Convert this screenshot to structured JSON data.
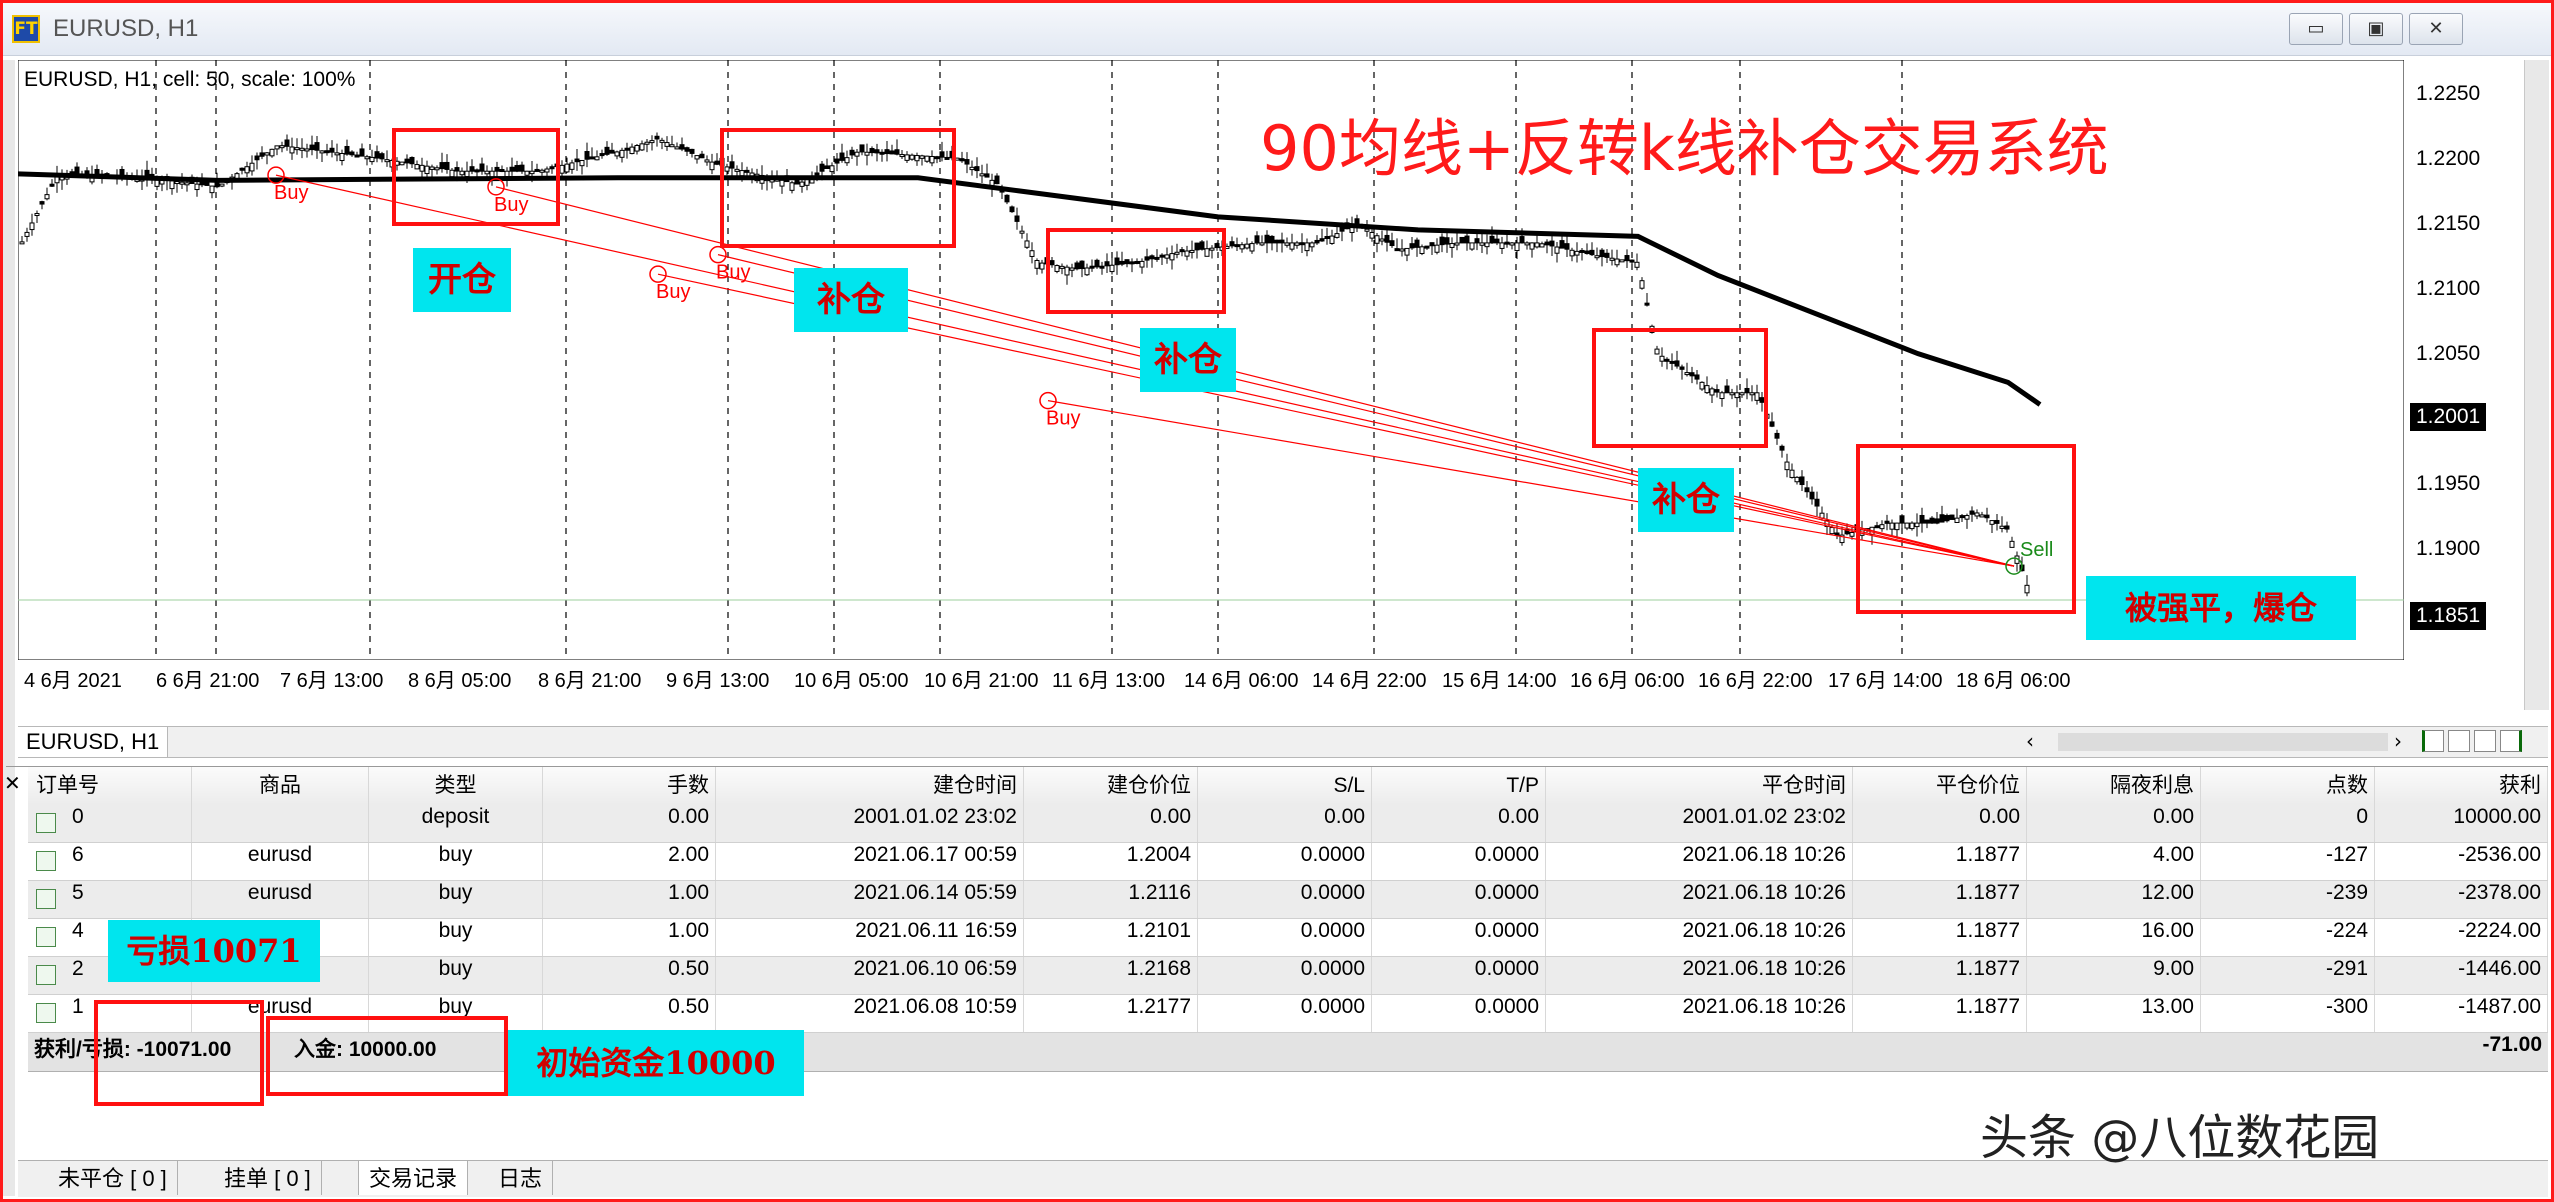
{
  "window": {
    "title": "EURUSD, H1",
    "minimize_glyph": "▭",
    "restore_glyph": "▣",
    "close_glyph": "✕",
    "app_icon_text": "FT"
  },
  "chart": {
    "info_label": "EURUSD, H1, cell: 50, scale: 100%",
    "headline": "90均线+反转k线补仓交易系统",
    "price_labels": [
      "1.2250",
      "1.2200",
      "1.2150",
      "1.2100",
      "1.2050",
      "1.2001",
      "1.1950",
      "1.1900",
      "1.1851"
    ],
    "current_price": "1.2001",
    "bid_price": "1.1851",
    "time_labels": [
      "4 6月 2021",
      "6 6月 21:00",
      "7 6月 13:00",
      "8 6月 05:00",
      "8 6月 21:00",
      "9 6月 13:00",
      "10 6月 05:00",
      "10 6月 21:00",
      "11 6月 13:00",
      "14 6月 06:00",
      "14 6月 22:00",
      "15 6月 14:00",
      "16 6月 06:00",
      "16 6月 22:00",
      "17 6月 14:00",
      "18 6月 06:00"
    ],
    "trade_markers": [
      "Buy",
      "Buy",
      "Buy",
      "Buy",
      "Buy",
      "Sell"
    ],
    "annotations": {
      "open": "开仓",
      "add1": "补仓",
      "add2": "补仓",
      "add3": "补仓",
      "liquidated": "被强平，爆仓",
      "loss": "亏损10071",
      "initial": "初始资金10000"
    }
  },
  "chart_tab": "EURUSD, H1",
  "table": {
    "headers": [
      "订单号",
      "商品",
      "类型",
      "手数",
      "建仓时间",
      "建仓价位",
      "S/L",
      "T/P",
      "平仓时间",
      "平仓价位",
      "隔夜利息",
      "点数",
      "获利"
    ],
    "rows": [
      [
        "0",
        "",
        "deposit",
        "0.00",
        "2001.01.02 23:02",
        "0.00",
        "0.00",
        "0.00",
        "2001.01.02 23:02",
        "0.00",
        "0.00",
        "0",
        "10000.00"
      ],
      [
        "6",
        "eurusd",
        "buy",
        "2.00",
        "2021.06.17 00:59",
        "1.2004",
        "0.0000",
        "0.0000",
        "2021.06.18 10:26",
        "1.1877",
        "4.00",
        "-127",
        "-2536.00"
      ],
      [
        "5",
        "eurusd",
        "buy",
        "1.00",
        "2021.06.14 05:59",
        "1.2116",
        "0.0000",
        "0.0000",
        "2021.06.18 10:26",
        "1.1877",
        "12.00",
        "-239",
        "-2378.00"
      ],
      [
        "4",
        "eurusd",
        "buy",
        "1.00",
        "2021.06.11 16:59",
        "1.2101",
        "0.0000",
        "0.0000",
        "2021.06.18 10:26",
        "1.1877",
        "16.00",
        "-224",
        "-2224.00"
      ],
      [
        "2",
        "eurusd",
        "buy",
        "0.50",
        "2021.06.10 06:59",
        "1.2168",
        "0.0000",
        "0.0000",
        "2021.06.18 10:26",
        "1.1877",
        "9.00",
        "-291",
        "-1446.00"
      ],
      [
        "1",
        "eurusd",
        "buy",
        "0.50",
        "2021.06.08 10:59",
        "1.2177",
        "0.0000",
        "0.0000",
        "2021.06.18 10:26",
        "1.1877",
        "13.00",
        "-300",
        "-1487.00"
      ]
    ],
    "summary_pl_label": "获利/亏损: -10071.00",
    "summary_deposit_label": "入金: 10000.00",
    "summary_total": "-71.00",
    "close_glyph": "✕"
  },
  "bottom_tabs": [
    "未平仓 [ 0 ]",
    "挂单 [ 0 ]",
    "交易记录",
    "日志"
  ],
  "active_tab": "交易记录",
  "watermark": "头条 @八位数花园",
  "colors": {
    "frame": "#ff1a1a",
    "annotation_bg": "#00e5ee",
    "annotation_text": "#d10000",
    "candle": "#000000",
    "trade_line": "#ff0000",
    "sell_marker": "#1a8a1a"
  },
  "icons": [
    "app-icon",
    "minimize-icon",
    "restore-icon",
    "close-icon",
    "scroll-left-icon",
    "scroll-right-icon",
    "deposit-icon",
    "buy-order-icon"
  ]
}
